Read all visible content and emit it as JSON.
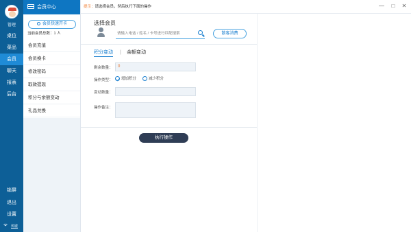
{
  "left_nav": {
    "username": "管理",
    "items": [
      {
        "label": "桌位",
        "active": false
      },
      {
        "label": "菜品",
        "active": false
      },
      {
        "label": "会员",
        "active": true
      },
      {
        "label": "聊天",
        "active": false
      },
      {
        "label": "报表",
        "active": false
      },
      {
        "label": "后台",
        "active": false
      }
    ],
    "bottom_items": [
      "锁屏",
      "退出",
      "设置"
    ],
    "hotkey_label": "热键",
    "accent_color": "#0d5f97",
    "active_color": "#1f8bd6"
  },
  "sub_nav": {
    "title": "会员中心",
    "quick_open_label": "会员快速开卡",
    "member_count_text": "当前会员总数：1 人",
    "items": [
      "会员充值",
      "会员换卡",
      "修改密码",
      "取款提现",
      "积分与余额变动",
      "礼品兑换"
    ]
  },
  "topbar": {
    "breadcrumb_first": "提示：",
    "breadcrumb_rest": "请选择会员，然后执行下面的操作",
    "controls": [
      "—",
      "□",
      "✕"
    ]
  },
  "main": {
    "select_title": "选择会员",
    "search_placeholder": "请输入电话 / 姓名 / 卡号进行匹配搜索",
    "guest_button": "散客消费",
    "tabs": [
      {
        "label": "积分变动",
        "active": true
      },
      {
        "label": "余额变动",
        "active": false
      }
    ],
    "tab_separator": "|",
    "form": {
      "remaining_label": "剩余数量：",
      "remaining_value": "0",
      "op_type_label": "操作类型：",
      "op_add_label": "增加积分",
      "op_reduce_label": "减少积分",
      "change_label": "变动数量：",
      "remark_label": "操作备注："
    },
    "execute_button": "执行操作"
  }
}
